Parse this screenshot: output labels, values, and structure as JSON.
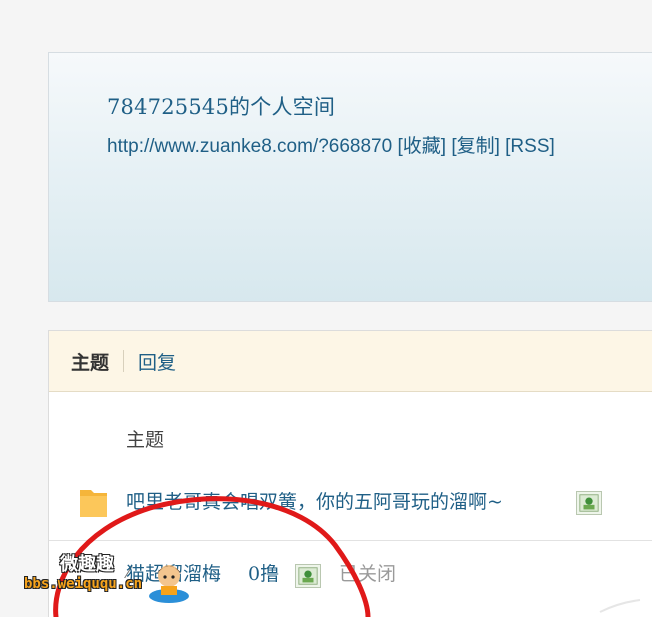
{
  "space": {
    "title": "784725545的个人空间",
    "url": "http://www.zuanke8.com/?668870",
    "links": [
      "[收藏]",
      "[复制]",
      "[RSS]"
    ]
  },
  "tabs": {
    "active": "主题",
    "reply": "回复"
  },
  "table": {
    "column_header": "主题"
  },
  "threads": [
    {
      "title": "吧里老哥真会唱双簧，你的五阿哥玩的溜啊~",
      "icon": "folder-icon",
      "attachment_icon": "image-icon"
    },
    {
      "title": "猫超溜溜梅",
      "count": "0撸",
      "attachment_icon": "image-icon",
      "status": "已关闭",
      "icon": "lock-icon"
    }
  ],
  "watermark": {
    "top": "微趣趣",
    "bottom": "bbs.weiququ.cn"
  },
  "colors": {
    "link": "#1f5f86",
    "tab_bar_bg": "#fdf6e6",
    "header_gradient_end": "#d7e8ee",
    "annotation_red": "#e01919",
    "watermark_orange": "#f6a31c"
  }
}
